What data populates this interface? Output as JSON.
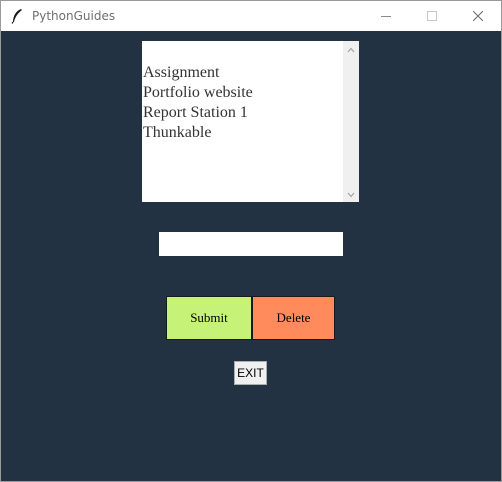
{
  "window": {
    "title": "PythonGuides"
  },
  "listbox": {
    "items": [
      "Assignment",
      "Portfolio website",
      "Report Station 1",
      "Thunkable"
    ]
  },
  "entry": {
    "value": ""
  },
  "buttons": {
    "submit_label": "Submit",
    "delete_label": "Delete",
    "exit_label": "EXIT"
  },
  "colors": {
    "background": "#223243",
    "submit": "#c6f377",
    "delete": "#ff8a5b",
    "exit": "#f0f0f0"
  },
  "icons": {
    "app": "feather-icon",
    "minimize": "minimize-icon",
    "maximize": "maximize-icon",
    "close": "close-icon"
  }
}
